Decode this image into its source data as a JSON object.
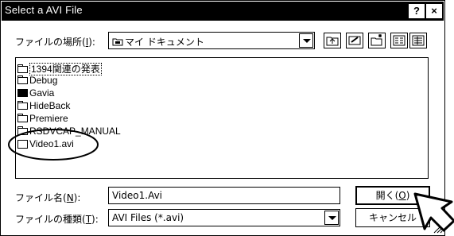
{
  "window": {
    "title": "Select a AVI File",
    "help_button": "?",
    "close_button": "×"
  },
  "lookin": {
    "label_prefix": "ファイルの場所(",
    "label_key": "I",
    "label_suffix": "):",
    "value": "マイ ドキュメント"
  },
  "files": [
    {
      "name": "1394関連の発表",
      "icon": "folder-icon"
    },
    {
      "name": "Debug",
      "icon": "folder-icon"
    },
    {
      "name": "Gavia",
      "icon": "special-folder-icon"
    },
    {
      "name": "HideBack",
      "icon": "folder-icon"
    },
    {
      "name": "Premiere",
      "icon": "folder-icon"
    },
    {
      "name": "RSDVCAP_MANUAL",
      "icon": "folder-icon"
    },
    {
      "name": "Video1.avi",
      "icon": "avi-file-icon"
    }
  ],
  "filename": {
    "label_prefix": "ファイル名(",
    "label_key": "N",
    "label_suffix": "):",
    "value": "Video1.Avi"
  },
  "filetype": {
    "label_prefix": "ファイルの種類(",
    "label_key": "T",
    "label_suffix": "):",
    "value": "AVI Files (*.avi)"
  },
  "buttons": {
    "open_prefix": "開く(",
    "open_key": "O",
    "open_suffix": ")",
    "cancel": "キャンセル"
  }
}
